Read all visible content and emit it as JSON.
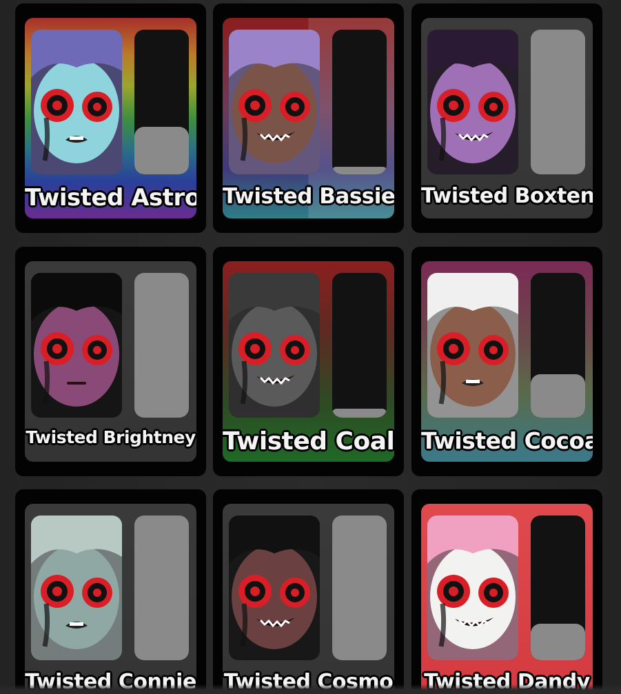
{
  "cards": [
    {
      "name": "Twisted Astro",
      "fill": 0.33,
      "bg": "linear-gradient(180deg,#a7302a 0%,#b97a2a 18%,#9aa52c 34%,#3f8f3e 50%,#2a6f86 66%,#2a3f9a 82%,#6a2c8f 100%)",
      "skin": "#8fd3dd",
      "hair": "#6e6ab8",
      "mouth": "frown"
    },
    {
      "name": "Twisted Bassie",
      "fill": 0.05,
      "bg": "linear-gradient(90deg,rgba(0,0,0,0) 50%,rgba(255,255,255,0.12) 50%),linear-gradient(180deg,#8a1e1e 0%,#6c3a57 45%,#3f3a7a 75%,#2f7d86 100%)",
      "skin": "#7a5448",
      "hair": "#9a83c9",
      "mouth": "grin"
    },
    {
      "name": "Twisted Boxten",
      "fill": 0.0,
      "bg": "linear-gradient(180deg,#3b3b3b 0%,#353535 100%)",
      "skin": "#a070b7",
      "hair": "#2a1a33",
      "mouth": "smile"
    },
    {
      "name": "Twisted Brightney",
      "fill": 0.0,
      "bg": "linear-gradient(180deg,#3a3a3a 0%,#343434 100%)",
      "skin": "#8a4a77",
      "hair": "#0b0b0b",
      "mouth": "flat"
    },
    {
      "name": "Twisted Coal",
      "fill": 0.06,
      "bg": "linear-gradient(180deg,#8a1f1f 0%,#5e2a22 35%,#2e4a24 70%,#1f6a26 100%)",
      "skin": "#5a5a5a",
      "hair": "#3a3a3a",
      "mouth": "jaw"
    },
    {
      "name": "Twisted Cocoa",
      "fill": 0.3,
      "bg": "linear-gradient(180deg,#7a2a55 0%,#6a4a4a 40%,#5a6a4a 65%,#3a7a8a 100%)",
      "skin": "#8a5e4a",
      "hair": "#f0f0f0",
      "mouth": "frown"
    },
    {
      "name": "Twisted Connie",
      "fill": 0.0,
      "bg": "linear-gradient(180deg,#3a3a3a 0%,#343434 100%)",
      "skin": "#8fa8a4",
      "hair": "#b8c9c4",
      "mouth": "frown"
    },
    {
      "name": "Twisted Cosmo",
      "fill": 0.0,
      "bg": "linear-gradient(180deg,#3a3a3a 0%,#343434 100%)",
      "skin": "#6a4040",
      "hair": "#111111",
      "mouth": "grin"
    },
    {
      "name": "Twisted Dandy",
      "fill": 0.25,
      "bg": "linear-gradient(180deg,#e0494d 0%,#d23a3f 100%)",
      "skin": "#f2f2f0",
      "hair": "#f0a0c0",
      "mouth": "grin"
    }
  ]
}
